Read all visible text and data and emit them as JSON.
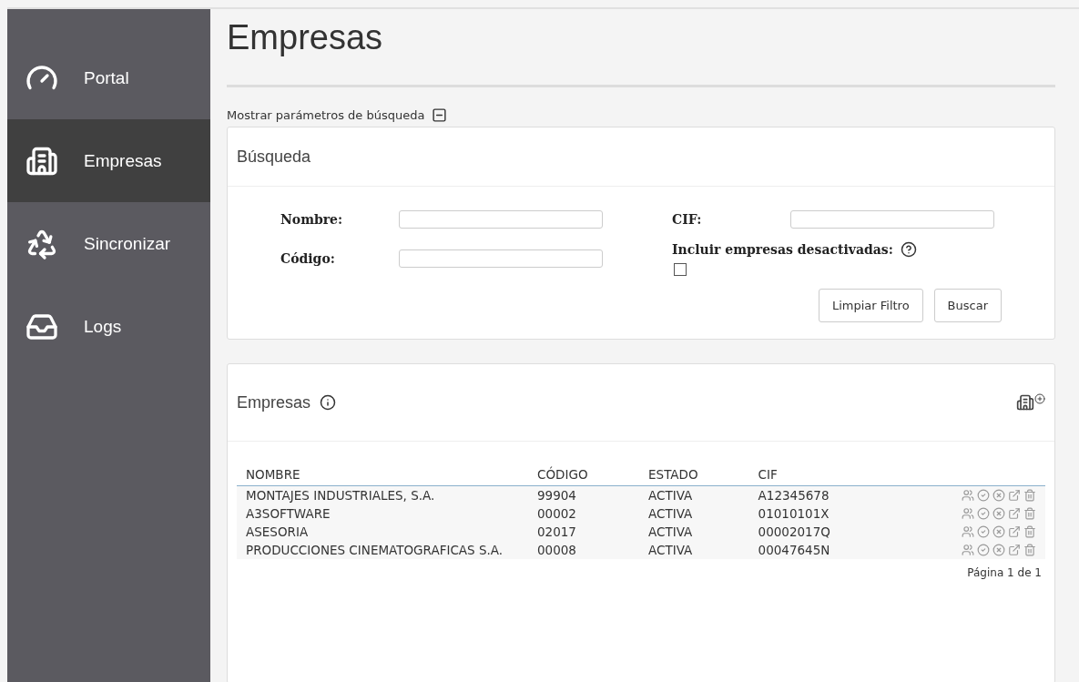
{
  "sidebar": {
    "items": [
      {
        "kind": "gauge",
        "label": "Portal",
        "selected": false
      },
      {
        "kind": "building",
        "label": "Empresas",
        "selected": true
      },
      {
        "kind": "recycle",
        "label": "Sincronizar",
        "selected": false
      },
      {
        "kind": "inbox",
        "label": "Logs",
        "selected": false
      }
    ]
  },
  "page_title": "Empresas",
  "toggle_label": "Mostrar parámetros de búsqueda",
  "search": {
    "title": "Búsqueda",
    "nombre_label": "Nombre:",
    "codigo_label": "Código:",
    "cif_label": "CIF:",
    "include_label": "Incluir empresas desactivadas:",
    "include_checked": false,
    "buttons": [
      "Limpiar Filtro",
      "Buscar"
    ]
  },
  "table": {
    "title": "Empresas",
    "columns": [
      "NOMBRE",
      "CÓDIGO",
      "ESTADO",
      "CIF"
    ],
    "rows": [
      {
        "nombre": "MONTAJES INDUSTRIALES, S.A.",
        "codigo": "99904",
        "estado": "ACTIVA",
        "cif": "A12345678"
      },
      {
        "nombre": "A3SOFTWARE",
        "codigo": "00002",
        "estado": "ACTIVA",
        "cif": "01010101X"
      },
      {
        "nombre": "ASESORIA",
        "codigo": "02017",
        "estado": "ACTIVA",
        "cif": "00002017Q"
      },
      {
        "nombre": "PRODUCCIONES CINEMATOGRAFICAS S.A.",
        "codigo": "00008",
        "estado": "ACTIVA",
        "cif": "00047645N"
      }
    ],
    "pagination": "Página 1 de 1"
  }
}
